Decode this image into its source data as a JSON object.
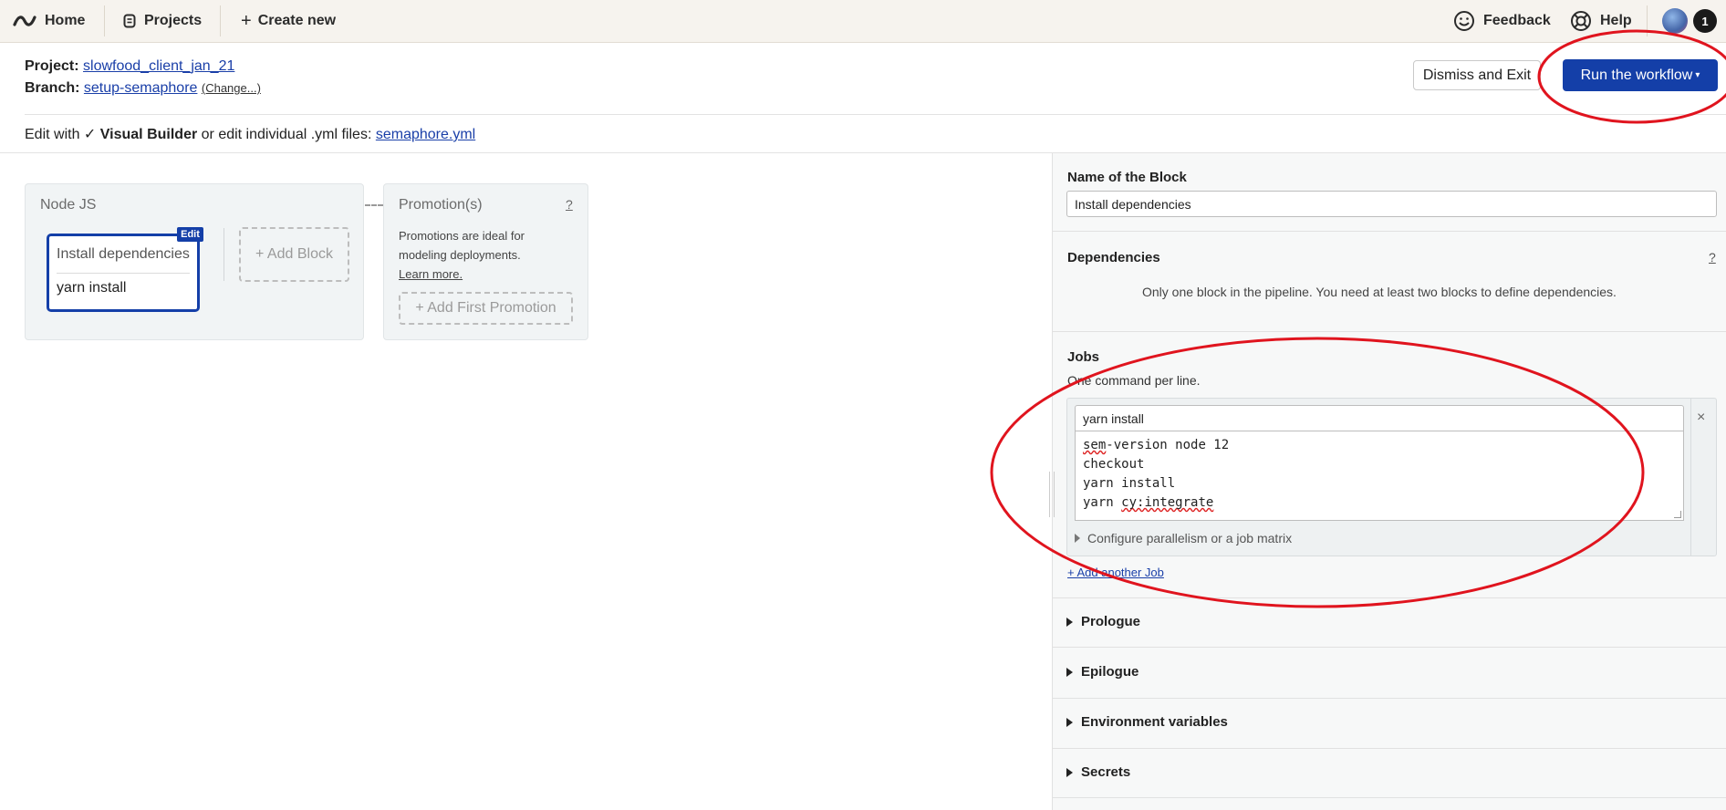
{
  "nav": {
    "home": "Home",
    "projects": "Projects",
    "create_new": "Create new",
    "feedback": "Feedback",
    "help": "Help",
    "notification_count": "1"
  },
  "project": {
    "project_label": "Project:",
    "project_name": "slowfood_client_jan_21",
    "branch_label": "Branch:",
    "branch_name": "setup-semaphore",
    "change_link": "(Change...)"
  },
  "actions": {
    "dismiss": "Dismiss and Exit",
    "run": "Run the workflow",
    "run_caret": "▾"
  },
  "editor_mode": {
    "prefix": "Edit with",
    "check": "✓",
    "visual_builder": "Visual Builder",
    "middle": "or edit individual .yml files:",
    "file_link": "semaphore.yml"
  },
  "pipeline": {
    "name": "Node JS",
    "block": {
      "name": "Install dependencies",
      "job": "yarn install",
      "edit_badge": "Edit"
    },
    "add_block": "+ Add Block"
  },
  "promotions": {
    "title": "Promotion(s)",
    "help": "?",
    "description_line1": "Promotions are ideal for",
    "description_line2": "modeling deployments.",
    "learn_more": "Learn more.",
    "add_first": "+ Add First Promotion"
  },
  "block_panel": {
    "name_label": "Name of the Block",
    "name_value": "Install dependencies",
    "dependencies_label": "Dependencies",
    "dependencies_help": "?",
    "dependencies_note": "Only one block in the pipeline. You need at least two blocks to define dependencies.",
    "jobs_label": "Jobs",
    "jobs_hint": "One command per line.",
    "job": {
      "name": "yarn install",
      "commands": [
        {
          "pre": "",
          "sq": "sem",
          "post": "-version node 12"
        },
        {
          "pre": "checkout",
          "sq": "",
          "post": ""
        },
        {
          "pre": "yarn install",
          "sq": "",
          "post": ""
        },
        {
          "pre": "yarn ",
          "sq": "cy:integrate",
          "post": ""
        }
      ],
      "remove": "×",
      "parallelism": "Configure parallelism or a job matrix"
    },
    "add_job": "+ Add another Job",
    "sections": [
      "Prologue",
      "Epilogue",
      "Environment variables",
      "Secrets"
    ]
  },
  "colors": {
    "primary": "#143fa8",
    "annotation": "#e0141e",
    "topbar_bg": "#f6f3ee",
    "panel_bg": "#f7f8f8"
  }
}
